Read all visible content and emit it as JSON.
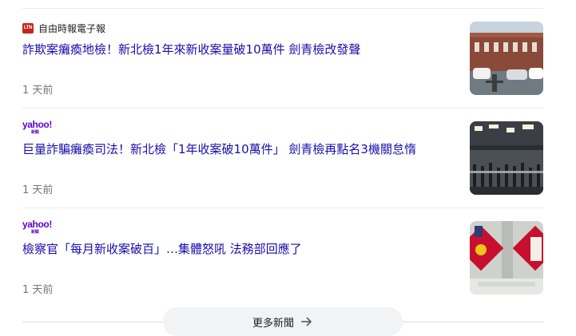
{
  "articles": [
    {
      "source": "自由時報電子報",
      "source_logo": "LTN",
      "headline": "詐欺案癱瘓地檢！新北檢1年來新收案量破10萬件 劍青檢改發聲",
      "time": "1 天前",
      "thumbnail_icon": "prosecutors-office-building-photo"
    },
    {
      "source": "yahoo!",
      "source_sub": "新聞",
      "headline": "巨量詐騙癱瘓司法！新北檢「1年收案破10萬件」 劍青檢再點名3機關怠惰",
      "time": "1 天前",
      "thumbnail_icon": "courthouse-lobby-photo"
    },
    {
      "source": "yahoo!",
      "source_sub": "新聞",
      "headline": "檢察官「每月新收案破百」…集體怒吼 法務部回應了",
      "time": "1 天前",
      "thumbnail_icon": "protest-signs-photo"
    }
  ],
  "more_news": {
    "label": "更多新聞",
    "icon": "arrow-right-icon"
  },
  "colors": {
    "headline": "#1a0dab",
    "meta": "#70757a",
    "yahoo": "#6001d2",
    "ltn": "#c4251f"
  }
}
